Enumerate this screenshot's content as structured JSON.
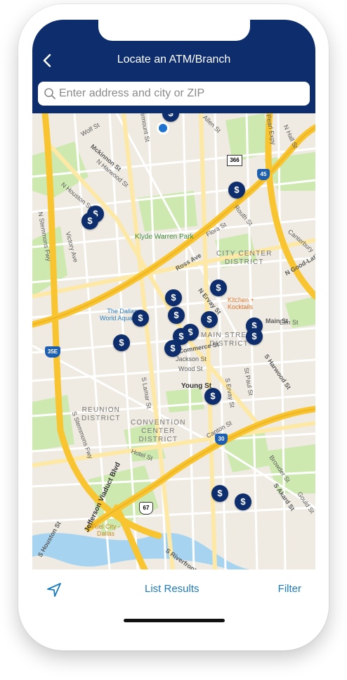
{
  "header": {
    "title": "Locate an ATM/Branch",
    "back_icon": "chevron-left-icon"
  },
  "search": {
    "placeholder": "Enter address and city or ZIP",
    "icon": "search-icon"
  },
  "map": {
    "streets": [
      "Wolf St",
      "Mckinnon St",
      "N Harwood St",
      "N Houston St",
      "N Stemmons Fwy",
      "Victory Ave",
      "Ross Ave",
      "Flora St",
      "Routh St",
      "N Ervay St",
      "Main St",
      "Jackson St",
      "Wood St",
      "Young St",
      "S Lamar St",
      "S Harwood St",
      "S Ervay St",
      "St Paul St",
      "Canton St",
      "Hotel St",
      "Jefferson Viaduct Blvd",
      "S Houston St",
      "S Akard St",
      "Browder St",
      "Gould St",
      "S Riverfront",
      "Allen St",
      "Commerce St",
      "Canterbury",
      "N Good-Latimer",
      "N Hall St",
      "S Stemmons Fwy",
      "Elm St",
      "Pearl Expy",
      "Fairmount St"
    ],
    "districts": [
      "CITY CENTER\nDISTRICT",
      "MAIN STREET\nDISTRICT",
      "REUNION\nDISTRICT",
      "CONVENTION\nCENTER\nDISTRICT"
    ],
    "pois": [
      "Klyde Warren Park",
      "The Dallas\nWorld Aquarium",
      "Kitchen +\nKocktails",
      "Fuel City -\nDallas"
    ],
    "shields": [
      "366",
      "45",
      "35E",
      "30",
      "67"
    ],
    "marker_symbol": "$"
  },
  "bottom_bar": {
    "locate_icon": "location-arrow-icon",
    "list_results": "List Results",
    "filter": "Filter"
  },
  "colors": {
    "header": "#0d2d6c",
    "marker": "#0d2d6c",
    "link": "#1c7bbd",
    "park": "#cde9b0",
    "highway": "#f8c531",
    "road": "#fde9a5"
  }
}
